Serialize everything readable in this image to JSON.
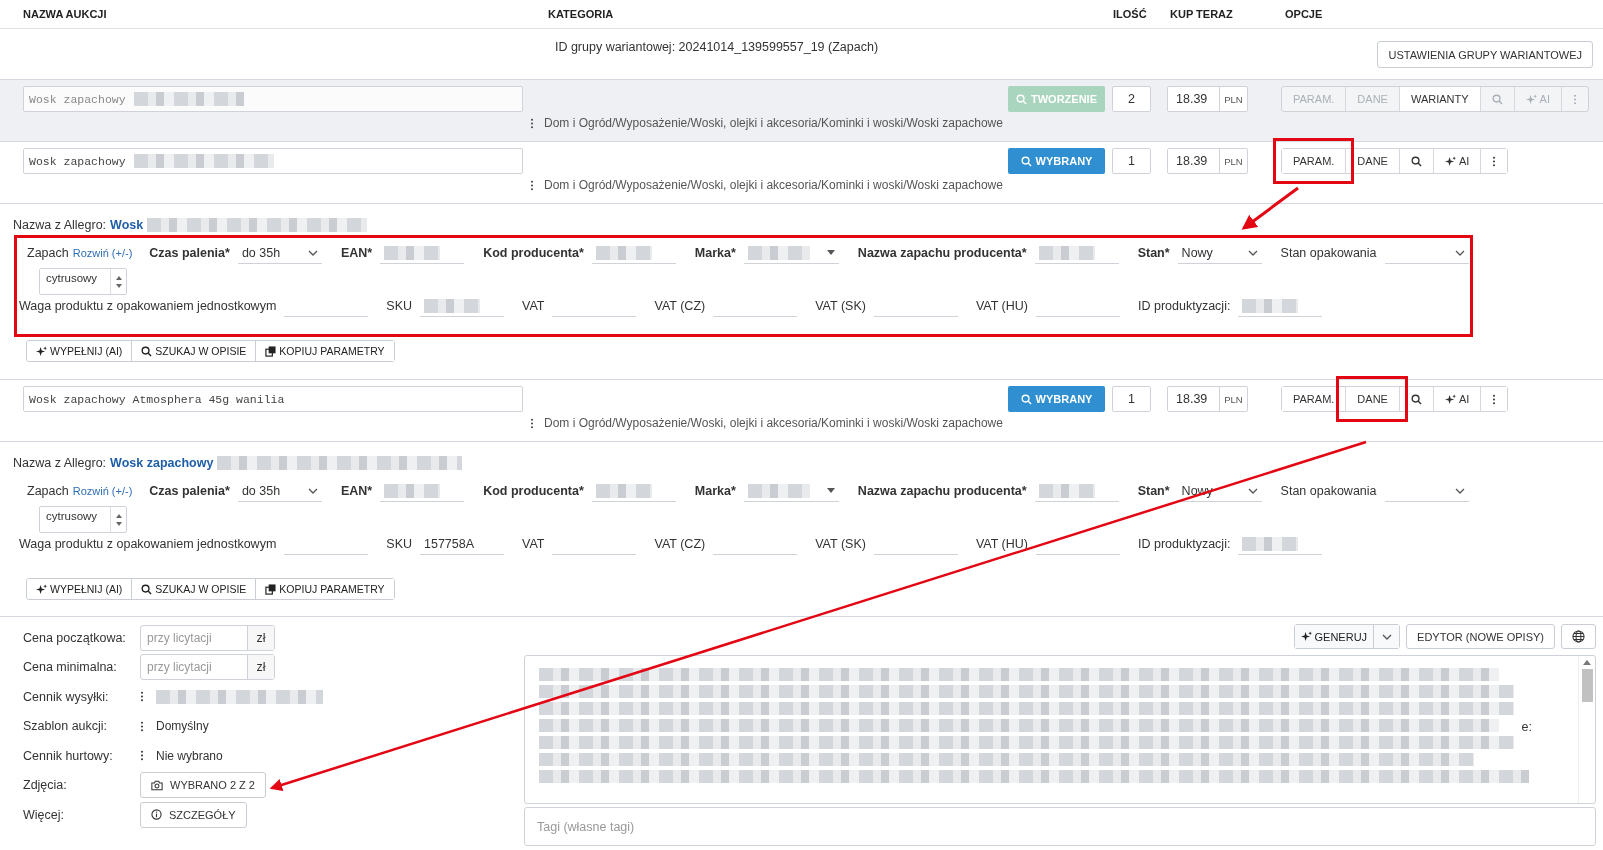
{
  "columns": [
    "NAZWA AUKCJI",
    "KATEGORIA",
    "ILOŚĆ",
    "KUP TERAZ",
    "OPCJE"
  ],
  "variant_group": {
    "id_text": "ID grupy wariantowej: 20241014_139599557_19 (Zapach)",
    "settings_button": "USTAWIENIA GRUPY WARIANTOWEJ"
  },
  "items": [
    {
      "name": "Wosk zapachowy",
      "name_obscured": true,
      "muted": true,
      "status": {
        "kind": "creating",
        "label": "TWORZENIE"
      },
      "quantity": "2",
      "price": "18.39",
      "currency": "PLN",
      "category": "Dom i Ogród/Wyposażenie/Woski, olejki i akcesoria/Kominki i woski/Woski zapachowe",
      "options": [
        {
          "kind": "text",
          "label": "PARAM.",
          "disabled": true,
          "highlighted": false
        },
        {
          "kind": "text",
          "label": "DANE",
          "disabled": true,
          "highlighted": false
        },
        {
          "kind": "text",
          "label": "WARIANTY",
          "disabled": false,
          "highlighted": false
        },
        {
          "kind": "search",
          "disabled": true,
          "highlighted": false
        },
        {
          "kind": "ai",
          "label": "AI",
          "disabled": true,
          "highlighted": false
        },
        {
          "kind": "more",
          "disabled": true,
          "highlighted": false
        }
      ]
    },
    {
      "name": "Wosk zapachowy",
      "name_obscured": true,
      "muted": false,
      "status": {
        "kind": "selected",
        "label": "WYBRANY"
      },
      "quantity": "1",
      "price": "18.39",
      "currency": "PLN",
      "category": "Dom i Ogród/Wyposażenie/Woski, olejki i akcesoria/Kominki i woski/Woski zapachowe",
      "options": [
        {
          "kind": "text",
          "label": "PARAM.",
          "disabled": false,
          "highlighted": true
        },
        {
          "kind": "text",
          "label": "DANE",
          "disabled": false,
          "highlighted": false
        },
        {
          "kind": "search",
          "disabled": false,
          "highlighted": false
        },
        {
          "kind": "ai",
          "label": "AI",
          "disabled": false,
          "highlighted": false
        },
        {
          "kind": "more",
          "disabled": false,
          "highlighted": false
        }
      ],
      "params": {
        "allegro_label": "Nazwa z Allegro:",
        "allegro_name": "Wosk",
        "allegro_obscured": true,
        "highlighted": true,
        "row1": [
          {
            "kind": "listbox",
            "label": "Zapach",
            "link": "Rozwiń (+/-)",
            "value": "cytrusowy"
          },
          {
            "kind": "select",
            "label": "Czas palenia*",
            "required": true,
            "value": "do 35h"
          },
          {
            "kind": "text",
            "label": "EAN*",
            "required": true,
            "obscured": true
          },
          {
            "kind": "text",
            "label": "Kod producenta*",
            "required": true,
            "obscured": true
          },
          {
            "kind": "combo",
            "label": "Marka*",
            "required": true,
            "obscured": true
          },
          {
            "kind": "text",
            "label": "Nazwa zapachu producenta*",
            "required": true,
            "obscured": true
          },
          {
            "kind": "select",
            "label": "Stan*",
            "required": true,
            "value": "Nowy"
          },
          {
            "kind": "select",
            "label": "Stan opakowania",
            "required": false
          }
        ],
        "row2": [
          {
            "kind": "text",
            "label": "Waga produktu z opakowaniem jednostkowym",
            "required": false
          },
          {
            "kind": "text",
            "label": "SKU",
            "required": false,
            "obscured": true
          },
          {
            "kind": "text",
            "label": "VAT",
            "required": false
          },
          {
            "kind": "text",
            "label": "VAT (CZ)",
            "required": false
          },
          {
            "kind": "text",
            "label": "VAT (SK)",
            "required": false
          },
          {
            "kind": "text",
            "label": "VAT (HU)",
            "required": false
          },
          {
            "kind": "text",
            "label": "ID produktyzacji:",
            "required": false,
            "obscured": true
          }
        ],
        "buttons": [
          {
            "kind": "ai",
            "label": "WYPEŁNIJ (AI)"
          },
          {
            "kind": "search",
            "label": "SZUKAJ W OPISIE"
          },
          {
            "kind": "copy",
            "label": "KOPIUJ PARAMETRY"
          }
        ]
      }
    },
    {
      "name": "Wosk zapachowy Atmosphera 45g wanilia",
      "name_obscured": false,
      "muted": false,
      "status": {
        "kind": "selected",
        "label": "WYBRANY"
      },
      "quantity": "1",
      "price": "18.39",
      "currency": "PLN",
      "category": "Dom i Ogród/Wyposażenie/Woski, olejki i akcesoria/Kominki i woski/Woski zapachowe",
      "options": [
        {
          "kind": "text",
          "label": "PARAM.",
          "disabled": false,
          "highlighted": false
        },
        {
          "kind": "text",
          "label": "DANE",
          "disabled": false,
          "highlighted": true
        },
        {
          "kind": "search",
          "disabled": false,
          "highlighted": false
        },
        {
          "kind": "ai",
          "label": "AI",
          "disabled": false,
          "highlighted": false
        },
        {
          "kind": "more",
          "disabled": false,
          "highlighted": false
        }
      ],
      "params": {
        "allegro_label": "Nazwa z Allegro:",
        "allegro_name": "Wosk zapachowy",
        "allegro_obscured": true,
        "highlighted": false,
        "row1": [
          {
            "kind": "listbox",
            "label": "Zapach",
            "link": "Rozwiń (+/-)",
            "value": "cytrusowy"
          },
          {
            "kind": "select",
            "label": "Czas palenia*",
            "required": true,
            "value": "do 35h"
          },
          {
            "kind": "text",
            "label": "EAN*",
            "required": true,
            "obscured": true
          },
          {
            "kind": "text",
            "label": "Kod producenta*",
            "required": true,
            "obscured": true
          },
          {
            "kind": "combo",
            "label": "Marka*",
            "required": true,
            "obscured": true
          },
          {
            "kind": "text",
            "label": "Nazwa zapachu producenta*",
            "required": true,
            "obscured": true
          },
          {
            "kind": "select",
            "label": "Stan*",
            "required": true,
            "value": "Nowy"
          },
          {
            "kind": "select",
            "label": "Stan opakowania",
            "required": false
          }
        ],
        "row2": [
          {
            "kind": "text",
            "label": "Waga produktu z opakowaniem jednostkowym",
            "required": false
          },
          {
            "kind": "text",
            "label": "SKU",
            "required": false,
            "value": "157758A"
          },
          {
            "kind": "text",
            "label": "VAT",
            "required": false
          },
          {
            "kind": "text",
            "label": "VAT (CZ)",
            "required": false
          },
          {
            "kind": "text",
            "label": "VAT (SK)",
            "required": false
          },
          {
            "kind": "text",
            "label": "VAT (HU)",
            "required": false
          },
          {
            "kind": "text",
            "label": "ID produktyzacji:",
            "required": false,
            "obscured": true
          }
        ],
        "buttons": [
          {
            "kind": "ai",
            "label": "WYPEŁNIJ (AI)"
          },
          {
            "kind": "search",
            "label": "SZUKAJ W OPISIE"
          },
          {
            "kind": "copy",
            "label": "KOPIUJ PARAMETRY"
          }
        ]
      }
    }
  ],
  "details": {
    "rows": [
      {
        "kind": "price",
        "label": "Cena początkowa:",
        "placeholder": "przy licytacji",
        "unit": "zł"
      },
      {
        "kind": "price",
        "label": "Cena minimalna:",
        "placeholder": "przy licytacji",
        "unit": "zł"
      },
      {
        "kind": "menu",
        "label": "Cennik wysyłki:",
        "obscured": true
      },
      {
        "kind": "menu",
        "label": "Szablon aukcji:",
        "value": "Domyślny"
      },
      {
        "kind": "menu",
        "label": "Cennik hurtowy:",
        "value": "Nie wybrano"
      },
      {
        "kind": "photos",
        "label": "Zdjęcia:",
        "button": "WYBRANO 2 Z 2"
      },
      {
        "kind": "details",
        "label": "Więcej:",
        "button": "SZCZEGÓŁY"
      }
    ],
    "generate_button": "GENERUJ",
    "editor_button": "EDYTOR (NOWE OPISY)",
    "description_fragment": "e:",
    "tags_placeholder": "Tagi (własne tagi)"
  }
}
